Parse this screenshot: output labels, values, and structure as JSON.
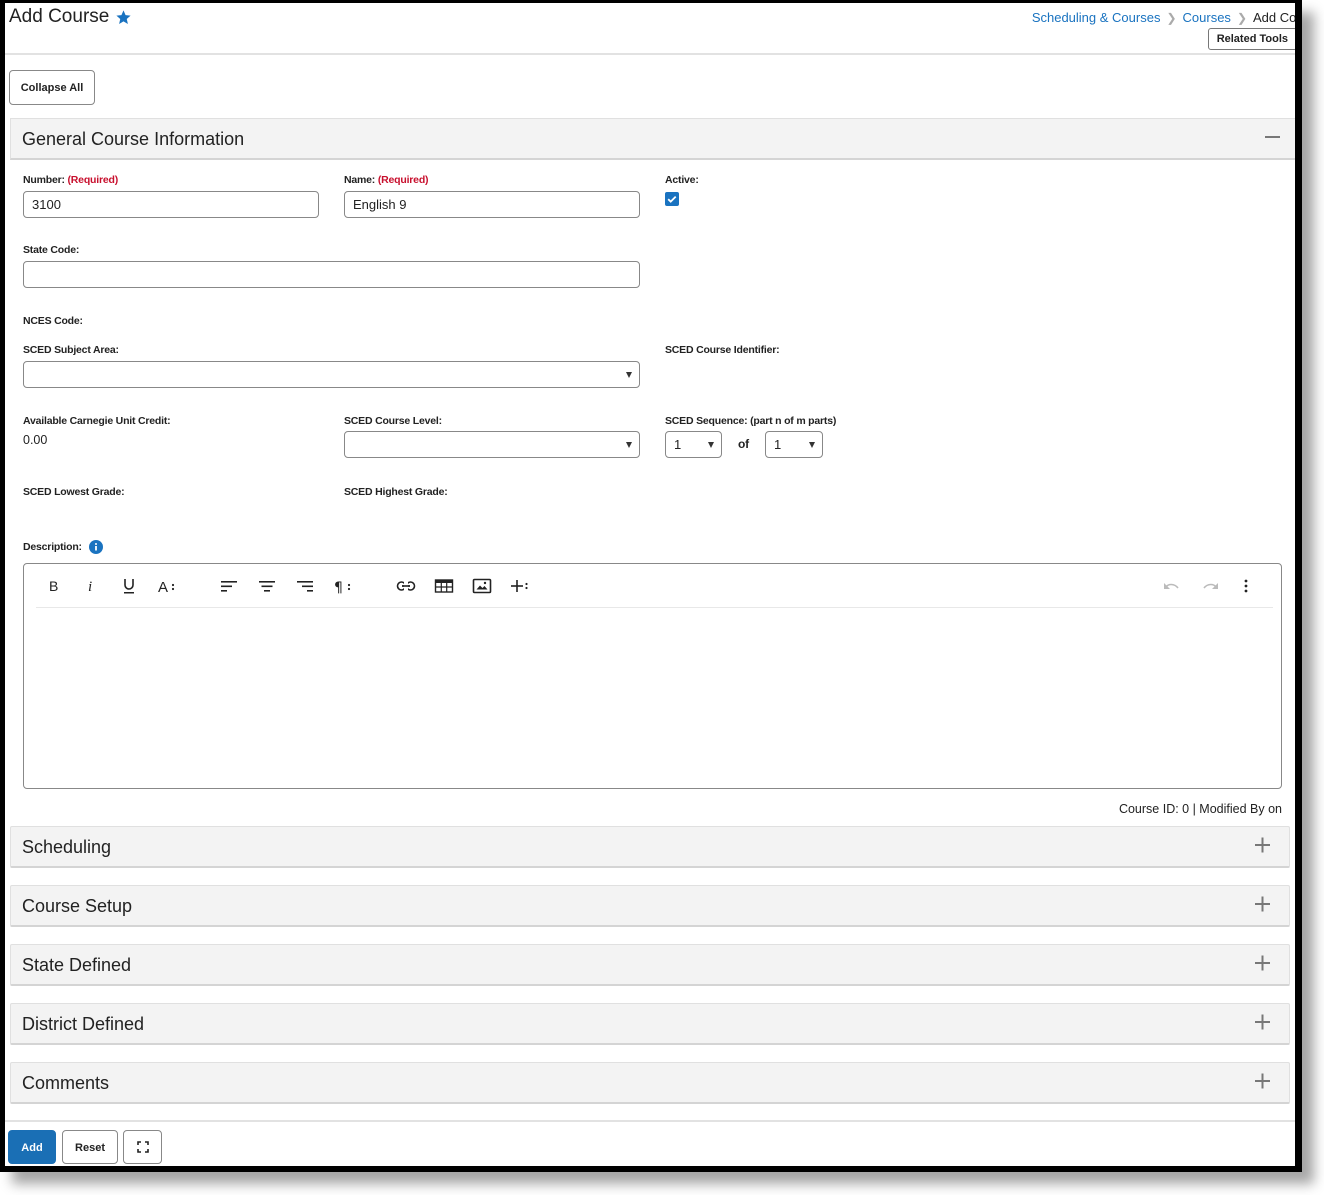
{
  "header": {
    "title": "Add Course",
    "favorite_icon": "star-icon",
    "breadcrumb": [
      {
        "label": "Scheduling & Courses"
      },
      {
        "label": "Courses"
      },
      {
        "label": "Add Course"
      }
    ],
    "related_tools_label": "Related Tools"
  },
  "toolbar": {
    "collapse_all_label": "Collapse All"
  },
  "general": {
    "title": "General Course Information",
    "toggle_icon": "minus-icon",
    "number": {
      "label": "Number:",
      "required": "(Required)",
      "value": "3100"
    },
    "name": {
      "label": "Name:",
      "required": "(Required)",
      "value": "English 9"
    },
    "active": {
      "label": "Active:",
      "checked": true
    },
    "state_code": {
      "label": "State Code:",
      "value": ""
    },
    "nces_code": {
      "label": "NCES Code:"
    },
    "sced_subject_area": {
      "label": "SCED Subject Area:",
      "value": ""
    },
    "sced_course_identifier": {
      "label": "SCED Course Identifier:"
    },
    "carnegie_credit": {
      "label": "Available Carnegie Unit Credit:",
      "value": "0.00"
    },
    "sced_course_level": {
      "label": "SCED Course Level:",
      "value": ""
    },
    "sced_sequence": {
      "label": "SCED Sequence: (part n of m parts)",
      "part": "1",
      "of_label": "of",
      "total": "1"
    },
    "sced_lowest_grade": {
      "label": "SCED Lowest Grade:"
    },
    "sced_highest_grade": {
      "label": "SCED Highest Grade:"
    },
    "description": {
      "label": "Description:",
      "info_icon": "info-icon",
      "value": "",
      "toolbar": [
        "bold",
        "italic",
        "underline",
        "font-size",
        "align-left",
        "align-center",
        "align-right",
        "paragraph",
        "link",
        "table",
        "image",
        "insert",
        "undo",
        "redo",
        "more"
      ]
    },
    "meta": "Course ID: 0 | Modified By on"
  },
  "sections": [
    {
      "title": "Scheduling",
      "expanded": false
    },
    {
      "title": "Course Setup",
      "expanded": false
    },
    {
      "title": "State Defined",
      "expanded": false
    },
    {
      "title": "District Defined",
      "expanded": false
    },
    {
      "title": "Comments",
      "expanded": false
    }
  ],
  "footer": {
    "add_label": "Add",
    "reset_label": "Reset",
    "fullscreen_icon": "fullscreen-icon"
  },
  "colors": {
    "accent": "#1a73c0",
    "required": "#c8102e",
    "primary_button": "#1a6fb5",
    "section_bg": "#f3f3f3"
  }
}
